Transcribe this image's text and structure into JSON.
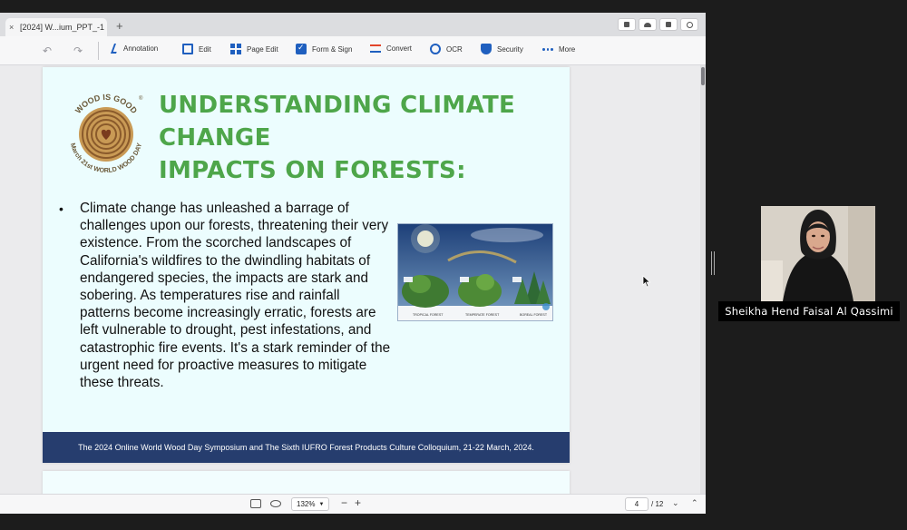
{
  "app": {
    "tab_title": "[2024] W...ium_PPT_-1",
    "tab_close": "×",
    "new_tab": "+"
  },
  "toolbar": {
    "undo": "↶",
    "redo": "↷",
    "tools": [
      {
        "label": "Annotation",
        "icon": "pen-icon"
      },
      {
        "label": "Edit",
        "icon": "edit-icon"
      },
      {
        "label": "Page Edit",
        "icon": "grid-icon"
      },
      {
        "label": "Form & Sign",
        "icon": "checkbox-icon"
      },
      {
        "label": "Convert",
        "icon": "convert-icon"
      },
      {
        "label": "OCR",
        "icon": "ocr-icon"
      },
      {
        "label": "Security",
        "icon": "shield-icon"
      },
      {
        "label": "More",
        "icon": "more-icon"
      }
    ]
  },
  "slide": {
    "logo_top": "WOOD IS GOOD",
    "logo_bottom": "March 21st WORLD WOOD DAY",
    "logo_mark": "®",
    "title_line1": "UNDERSTANDING CLIMATE CHANGE",
    "title_line2": "IMPACTS ON FORESTS:",
    "bullet": "•",
    "body": "Climate change has unleashed a barrage of challenges upon our forests, threatening their very existence. From the scorched landscapes of California's wildfires to the dwindling habitats of endangered species, the impacts are stark and sobering. As temperatures rise and rainfall patterns become increasingly erratic, forests are left vulnerable to drought, pest infestations, and catastrophic fire events. It's a stark reminder of the urgent need for proactive measures to mitigate these threats.",
    "photo_labels": [
      "TROPICAL FOREST",
      "TEMPERATE FOREST",
      "BOREAL FOREST"
    ],
    "footer": "The 2024 Online World Wood Day Symposium and The Sixth IUFRO Forest Products Culture Colloquium, 21-22 March, 2024."
  },
  "status": {
    "zoom": "132%",
    "zoom_out": "−",
    "zoom_in": "+",
    "current_page": "4",
    "total_pages": "/ 12"
  },
  "participant": {
    "name": "Sheikha Hend Faisal Al Qassimi"
  },
  "colors": {
    "title_green": "#4ea64a",
    "footer_navy": "#263d6e",
    "slide_bg": "#ecfdfe",
    "accent_blue": "#1f5fbf"
  }
}
